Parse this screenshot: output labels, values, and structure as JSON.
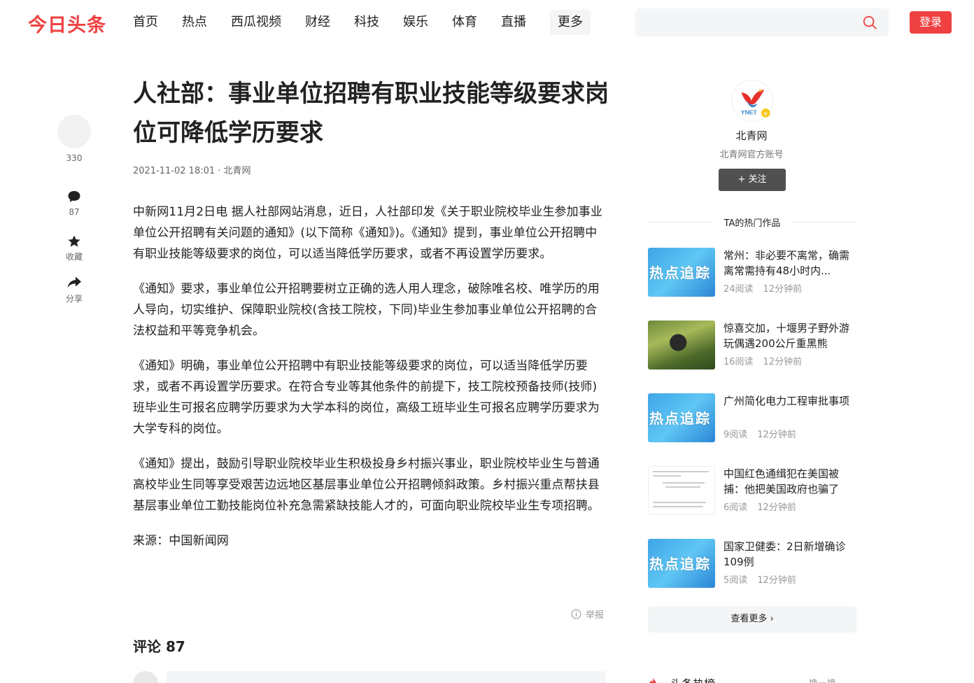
{
  "header": {
    "logo": "今日头条",
    "nav": [
      "首页",
      "热点",
      "西瓜视频",
      "财经",
      "科技",
      "娱乐",
      "体育",
      "直播",
      "更多"
    ],
    "search_placeholder": "",
    "login_label": "登录"
  },
  "rail": {
    "like_count": "330",
    "comment_count": "87",
    "favorite_label": "收藏",
    "share_label": "分享"
  },
  "article": {
    "title": "人社部：事业单位招聘有职业技能等级要求岗位可降低学历要求",
    "meta": "2021-11-02 18:01 · 北青网",
    "paragraphs": [
      "中新网11月2日电 据人社部网站消息，近日，人社部印发《关于职业院校毕业生参加事业单位公开招聘有关问题的通知》(以下简称《通知》)。《通知》提到，事业单位公开招聘中有职业技能等级要求的岗位，可以适当降低学历要求，或者不再设置学历要求。",
      "《通知》要求，事业单位公开招聘要树立正确的选人用人理念，破除唯名校、唯学历的用人导向，切实维护、保障职业院校(含技工院校，下同)毕业生参加事业单位公开招聘的合法权益和平等竞争机会。",
      "《通知》明确，事业单位公开招聘中有职业技能等级要求的岗位，可以适当降低学历要求，或者不再设置学历要求。在符合专业等其他条件的前提下，技工院校预备技师(技师)班毕业生可报名应聘学历要求为大学本科的岗位，高级工班毕业生可报名应聘学历要求为大学专科的岗位。",
      "《通知》提出，鼓励引导职业院校毕业生积极投身乡村振兴事业，职业院校毕业生与普通高校毕业生同等享受艰苦边远地区基层事业单位公开招聘倾斜政策。乡村振兴重点帮扶县基层事业单位工勤技能岗位补充急需紧缺技能人才的，可面向职业院校毕业生专项招聘。",
      "来源：中国新闻网"
    ],
    "report_label": "举报",
    "comments_title": "评论 87"
  },
  "sidebar": {
    "logo_text": "YNET",
    "author_name": "北青网",
    "author_desc": "北青网官方账号",
    "follow_label": "+ 关注",
    "hot_heading": "TA的热门作品",
    "thumb_overlay_text": "热点追踪",
    "hot_items": [
      {
        "title": "常州：非必要不离常，确需离常需持有48小时内...",
        "reads": "24阅读",
        "time": "12分钟前",
        "thumb": "blue"
      },
      {
        "title": "惊喜交加，十堰男子野外游玩偶遇200公斤重黑熊",
        "reads": "16阅读",
        "time": "12分钟前",
        "thumb": "forest"
      },
      {
        "title": "广州简化电力工程审批事项",
        "reads": "9阅读",
        "time": "12分钟前",
        "thumb": "blue"
      },
      {
        "title": "中国红色通缉犯在美国被捕：他把美国政府也骗了",
        "reads": "6阅读",
        "time": "12分钟前",
        "thumb": "doc"
      },
      {
        "title": "国家卫健委：2日新增确诊109例",
        "reads": "5阅读",
        "time": "12分钟前",
        "thumb": "blue"
      }
    ],
    "see_more_label": "查看更多 ›",
    "hot_rank_label": "头条热榜",
    "refresh_label": "换一换"
  },
  "colors": {
    "brand": "#f04142",
    "follow_bg": "#505050"
  }
}
